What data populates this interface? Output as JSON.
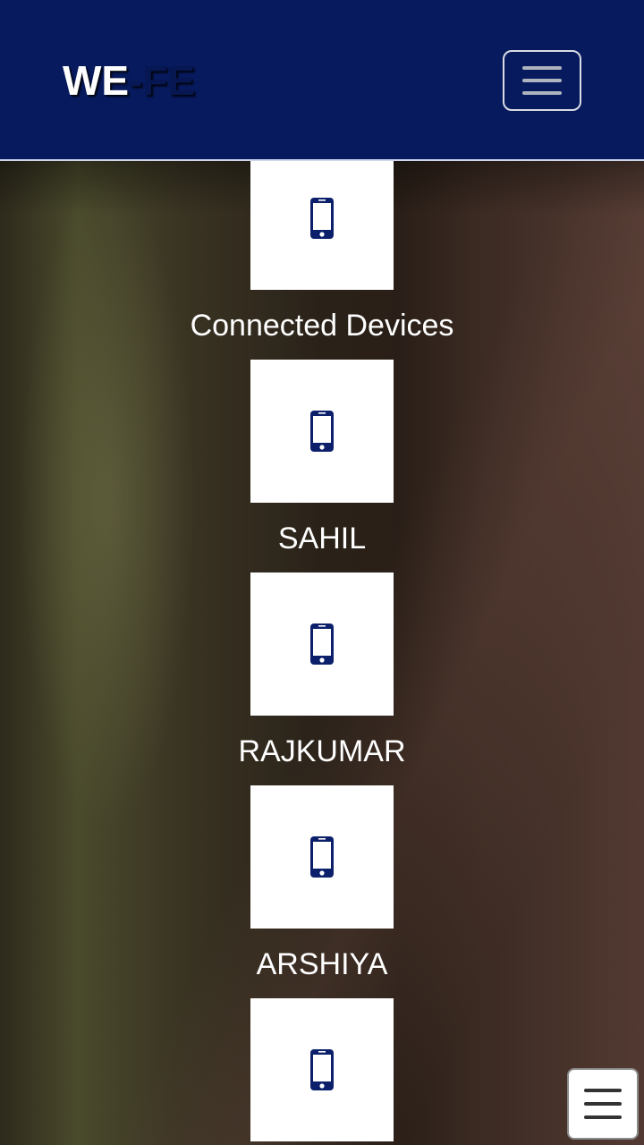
{
  "header": {
    "brand_we": "WE",
    "brand_fe": "-FE",
    "menu_icon": "hamburger-icon",
    "background_color": "#071a5e"
  },
  "devices": [
    {
      "name": "",
      "icon": "smartphone-icon"
    },
    {
      "name": "Connected Devices",
      "icon": "smartphone-icon"
    },
    {
      "name": "SAHIL",
      "icon": "smartphone-icon"
    },
    {
      "name": "RAJKUMAR",
      "icon": "smartphone-icon"
    },
    {
      "name": "ARSHIYA",
      "icon": "smartphone-icon"
    }
  ],
  "floating_menu": {
    "icon": "hamburger-icon"
  },
  "colors": {
    "accent": "#071a5e",
    "card": "#ffffff",
    "text": "#ffffff"
  }
}
